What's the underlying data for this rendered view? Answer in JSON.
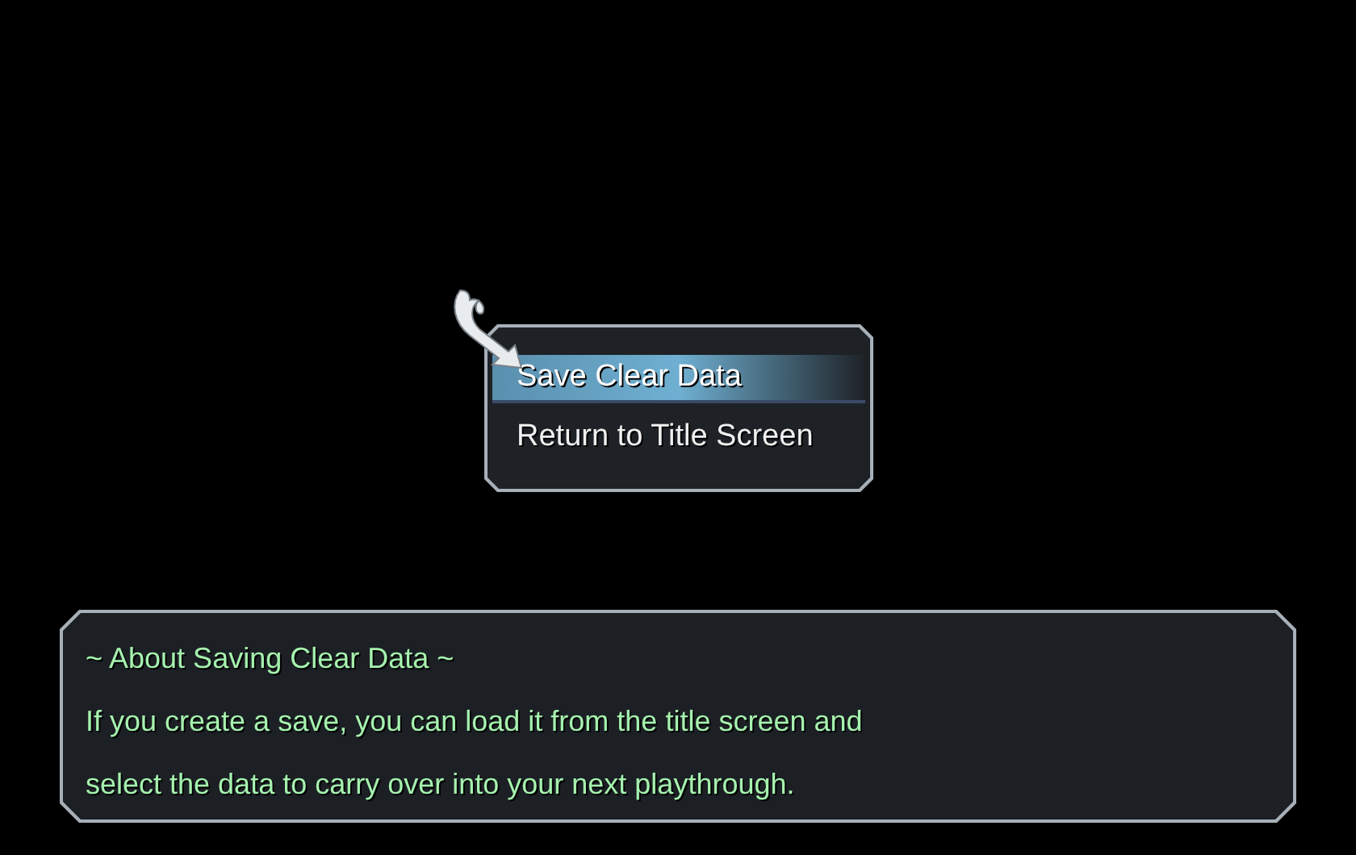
{
  "menu": {
    "items": [
      {
        "label": "Save Clear Data",
        "selected": true
      },
      {
        "label": "Return to Title Screen",
        "selected": false
      }
    ]
  },
  "help": {
    "title": "~ About Saving Clear Data ~",
    "lines": [
      "If you create a save, you can load it from the title screen and",
      "select the data to carry over into your next playthrough."
    ]
  }
}
